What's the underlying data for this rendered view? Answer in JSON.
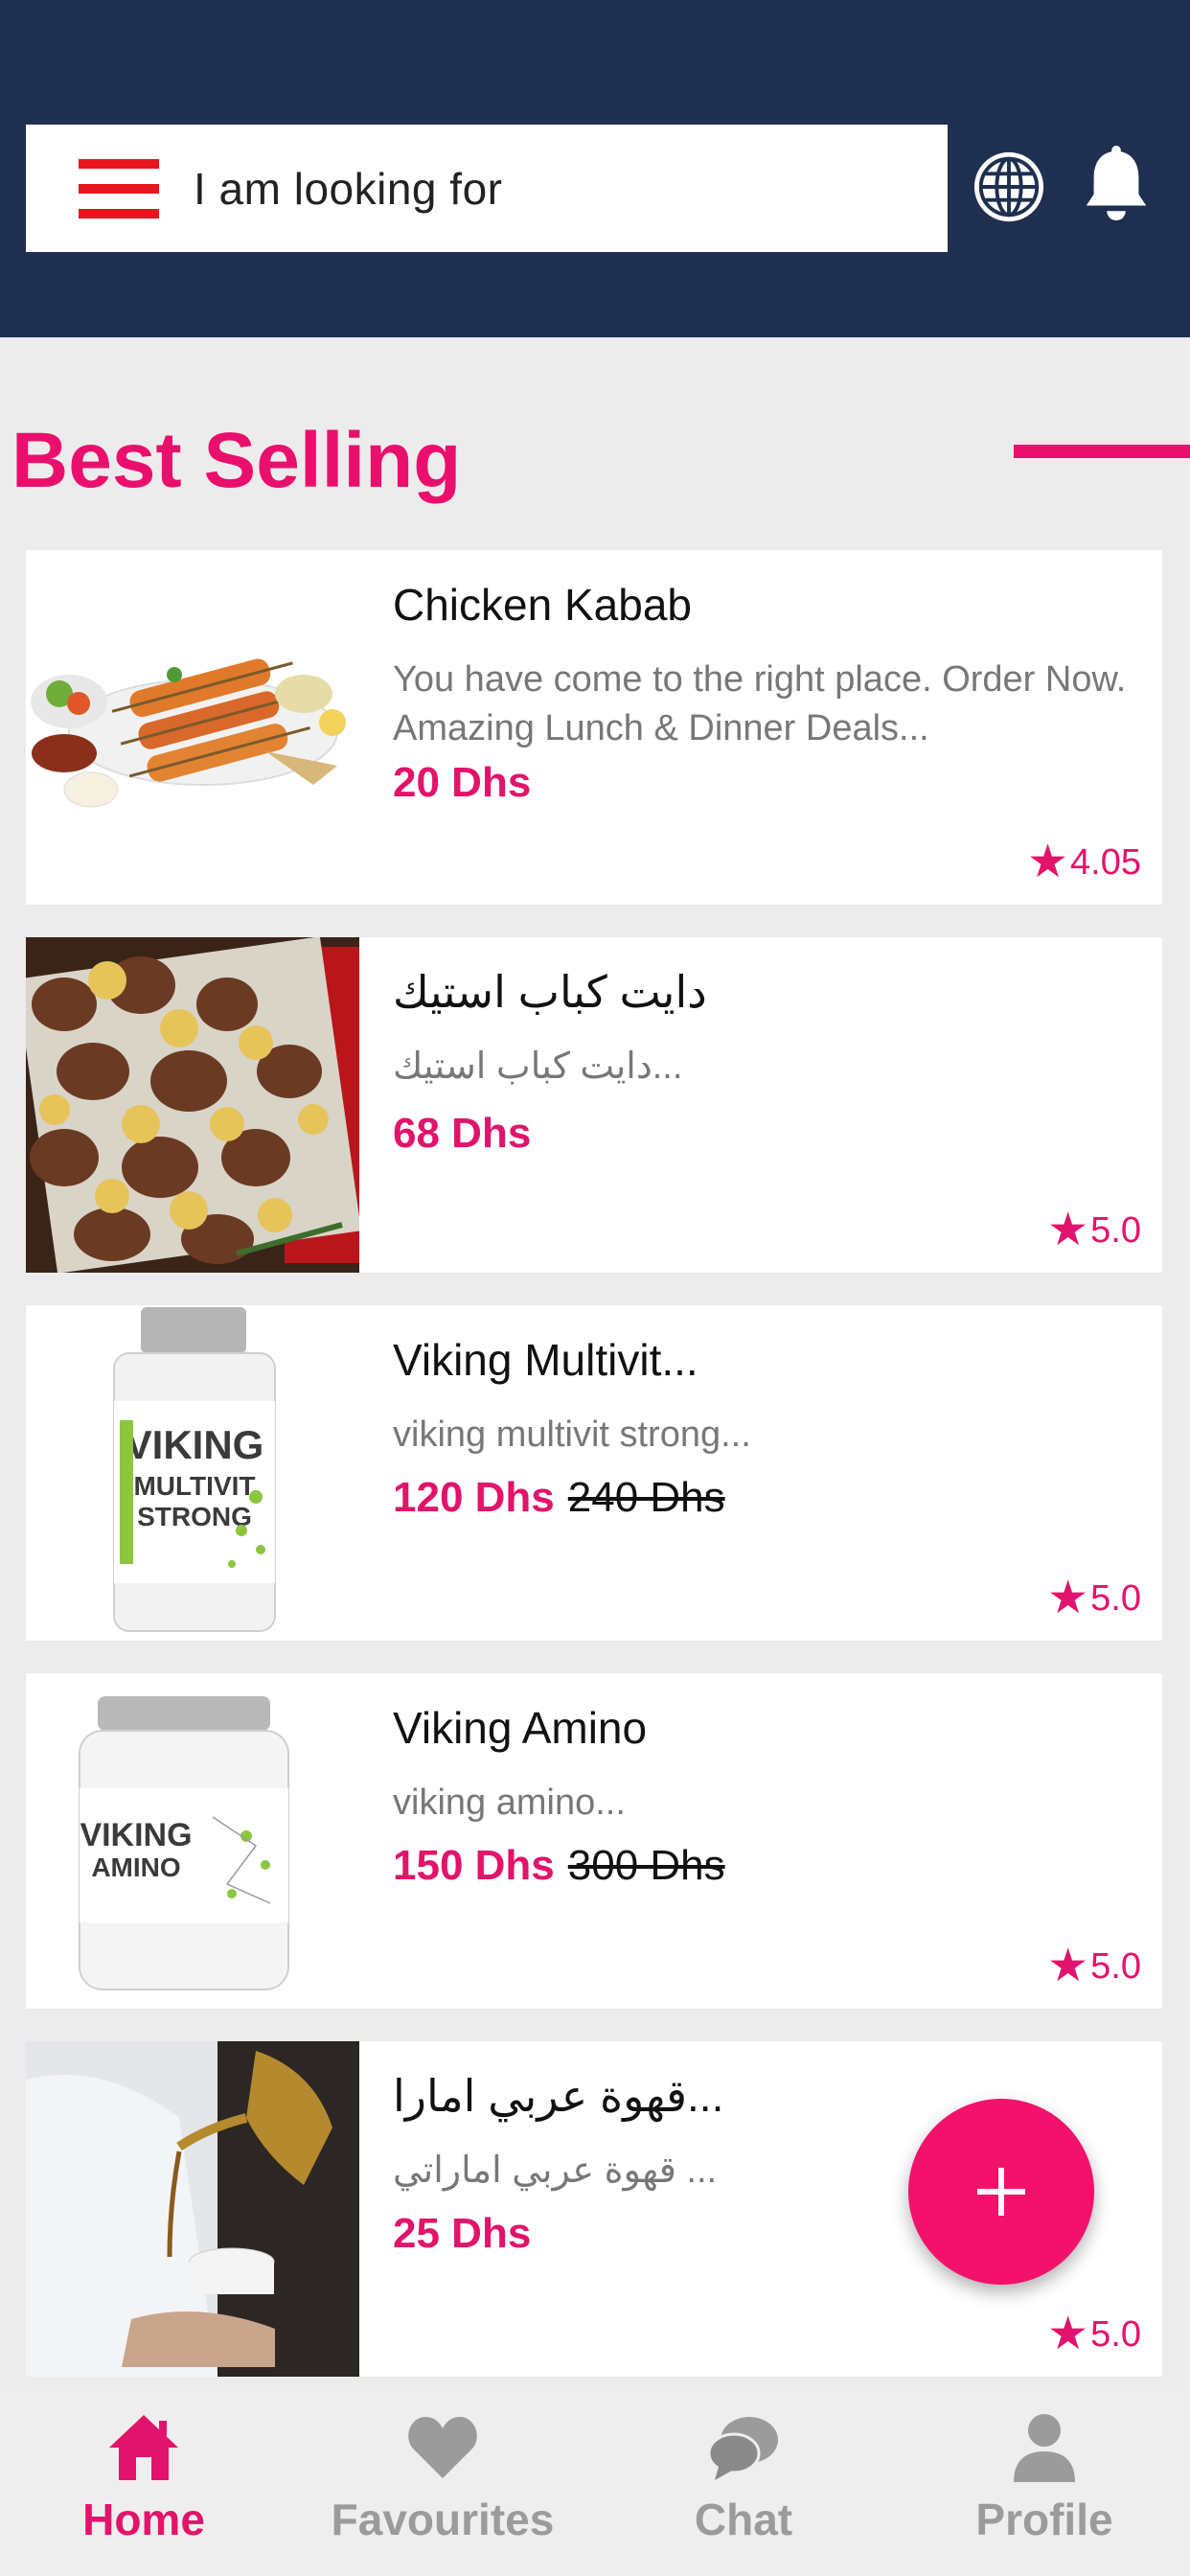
{
  "header": {
    "search_placeholder": "I am looking for"
  },
  "section": {
    "title": "Best Selling"
  },
  "products": [
    {
      "name": "Chicken Kabab",
      "description": "You have come to the right place. Order Now. Amazing Lunch & Dinner Deals...",
      "price": "20 Dhs",
      "old_price": "",
      "rating": "4.05"
    },
    {
      "name": "دايت كباب استيك",
      "description": "دايت كباب استيك...",
      "price": "68 Dhs",
      "old_price": "",
      "rating": "5.0"
    },
    {
      "name": "Viking Multivit...",
      "description": "viking multivit strong...",
      "price": "120 Dhs",
      "old_price": "240 Dhs",
      "rating": "5.0"
    },
    {
      "name": "Viking Amino",
      "description": "viking amino...",
      "price": "150 Dhs",
      "old_price": "300 Dhs",
      "rating": "5.0"
    },
    {
      "name": "قهوة عربي امارا...",
      "description": "قهوة عربي اماراتي ...",
      "price": "25 Dhs",
      "old_price": "",
      "rating": "5.0"
    }
  ],
  "product_images": {
    "viking_multivit_label": [
      "VIKING",
      "MULTIVIT",
      "STRONG"
    ],
    "viking_amino_label": [
      "VIKING",
      "AMINO"
    ]
  },
  "bottom_nav": {
    "home": "Home",
    "favourites": "Favourites",
    "chat": "Chat",
    "profile": "Profile"
  },
  "colors": {
    "header_bg": "#1f2f4f",
    "accent": "#ea0f6d",
    "hamburger": "#e8141e"
  }
}
